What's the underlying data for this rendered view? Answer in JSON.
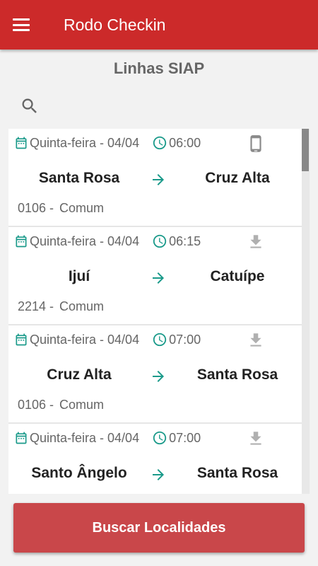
{
  "appbar": {
    "title": "Rodo Checkin"
  },
  "page": {
    "title": "Linhas SIAP"
  },
  "colors": {
    "primary": "#cc2a2a",
    "accent": "#1a9a8a",
    "button": "#c9474a"
  },
  "trips": [
    {
      "date": "Quinta-feira - 04/04",
      "time": "06:00",
      "origin": "Santa Rosa",
      "destination": "Cruz Alta",
      "code": "0106 -",
      "type": "Comum",
      "status_icon": "phone-icon"
    },
    {
      "date": "Quinta-feira - 04/04",
      "time": "06:15",
      "origin": "Ijuí",
      "destination": "Catuípe",
      "code": "2214 -",
      "type": "Comum",
      "status_icon": "download-icon"
    },
    {
      "date": "Quinta-feira - 04/04",
      "time": "07:00",
      "origin": "Cruz Alta",
      "destination": "Santa Rosa",
      "code": "0106 -",
      "type": "Comum",
      "status_icon": "download-icon"
    },
    {
      "date": "Quinta-feira - 04/04",
      "time": "07:00",
      "origin": "Santo Ângelo",
      "destination": "Santa Rosa",
      "code": "",
      "type": "",
      "status_icon": "download-icon"
    }
  ],
  "actions": {
    "search_button": "Buscar Localidades"
  }
}
